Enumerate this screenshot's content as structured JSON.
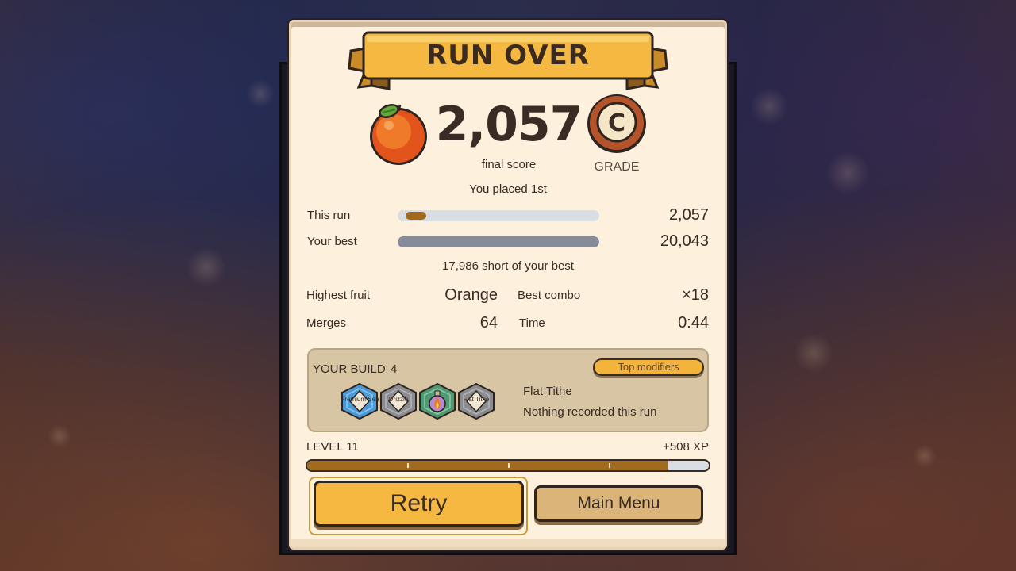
{
  "title": "RUN OVER",
  "score": {
    "value": "2,057",
    "label": "final score",
    "fruit_icon": "orange-icon"
  },
  "grade": {
    "letter": "C",
    "label": "GRADE"
  },
  "placed": "You placed 1st",
  "comparison": {
    "this_run": {
      "label": "This run",
      "value": "2,057",
      "fraction": 0.103
    },
    "your_best": {
      "label": "Your best",
      "value": "20,043",
      "fraction": 1.0
    },
    "short_text": "17,986 short of your best"
  },
  "stats": {
    "highest_fruit": {
      "label": "Highest fruit",
      "value": "Orange"
    },
    "best_combo": {
      "label": "Best combo",
      "value": "×18"
    },
    "merges": {
      "label": "Merges",
      "value": "64"
    },
    "time": {
      "label": "Time",
      "value": "0:44"
    }
  },
  "build": {
    "title": "YOUR BUILD",
    "count": "4",
    "top_modifiers_button": "Top modifiers",
    "modifiers": [
      {
        "name": "Premium Seal",
        "color": "#4a9ad8",
        "icon": "diamond-card-icon"
      },
      {
        "name": "Drizzle",
        "color": "#8a8c90",
        "icon": "diamond-card-icon"
      },
      {
        "name": "Fire Potion",
        "color": "#4f9a72",
        "icon": "flame-potion-icon"
      },
      {
        "name": "Flat Tithe",
        "color": "#8a8c90",
        "icon": "diamond-card-icon"
      }
    ],
    "selected_name": "Flat Tithe",
    "selected_desc": "Nothing recorded this run"
  },
  "level": {
    "label": "LEVEL 11",
    "xp_gain": "+508 XP",
    "progress": 0.9
  },
  "buttons": {
    "retry": "Retry",
    "main_menu": "Main Menu"
  },
  "colors": {
    "panel": "#fdf0dc",
    "ribbon": "#f5b942",
    "accent_brown": "#a06b1f",
    "grade_ring": "#b5532a"
  }
}
